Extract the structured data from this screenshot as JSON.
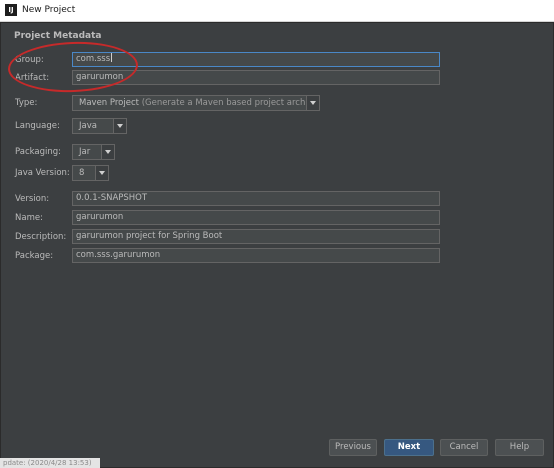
{
  "window": {
    "title": "New Project",
    "app_icon": "IJ"
  },
  "section_title": "Project Metadata",
  "fields": {
    "group": {
      "label": "Group:",
      "value": "com.sss"
    },
    "artifact": {
      "label": "Artifact:",
      "value": "garurumon"
    },
    "type": {
      "label": "Type:",
      "value": "Maven Project",
      "hint": "(Generate a Maven based project archive.)"
    },
    "language": {
      "label": "Language:",
      "value": "Java"
    },
    "packaging": {
      "label": "Packaging:",
      "value": "Jar"
    },
    "java_version": {
      "label": "Java Version:",
      "value": "8"
    },
    "version": {
      "label": "Version:",
      "value": "0.0.1-SNAPSHOT"
    },
    "name": {
      "label": "Name:",
      "value": "garurumon"
    },
    "description": {
      "label": "Description:",
      "value": "garurumon project for Spring Boot"
    },
    "package": {
      "label": "Package:",
      "value": "com.sss.garurumon"
    }
  },
  "buttons": {
    "previous": "Previous",
    "next": "Next",
    "cancel": "Cancel",
    "help": "Help"
  },
  "status_fragment": "pdate: (2020/4/28 13:53)",
  "colors": {
    "background": "#3c3f41",
    "field": "#45494a",
    "focus_border": "#4a88c7",
    "primary_button": "#365880",
    "annotation": "#c62a2a"
  }
}
